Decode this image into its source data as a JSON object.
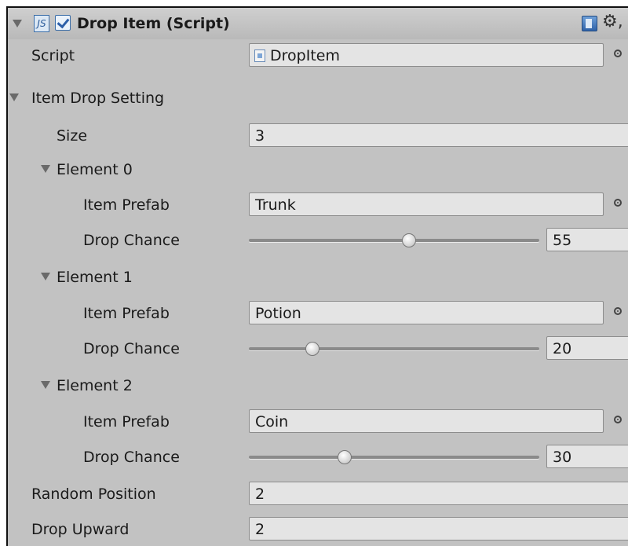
{
  "component": {
    "title": "Drop Item (Script)",
    "js_badge": "JS",
    "enabled": true,
    "gear_glyph": "⚙,"
  },
  "script": {
    "label": "Script",
    "value": "DropItem"
  },
  "item_drop_setting": {
    "label": "Item Drop Setting",
    "size_label": "Size",
    "size_value": "3",
    "elements": [
      {
        "label": "Element 0",
        "prefab_label": "Item Prefab",
        "prefab": "Trunk",
        "chance_label": "Drop Chance",
        "chance": "55",
        "slider_fraction": 0.55
      },
      {
        "label": "Element 1",
        "prefab_label": "Item Prefab",
        "prefab": "Potion",
        "chance_label": "Drop Chance",
        "chance": "20",
        "slider_fraction": 0.22
      },
      {
        "label": "Element 2",
        "prefab_label": "Item Prefab",
        "prefab": "Coin",
        "chance_label": "Drop Chance",
        "chance": "30",
        "slider_fraction": 0.33
      }
    ]
  },
  "random_position": {
    "label": "Random Position",
    "value": "2"
  },
  "drop_upward": {
    "label": "Drop Upward",
    "value": "2"
  },
  "colors": {
    "panel_bg": "#c2c2c2",
    "field_bg": "#e4e4e4",
    "accent_blue": "#2d5fa8"
  }
}
